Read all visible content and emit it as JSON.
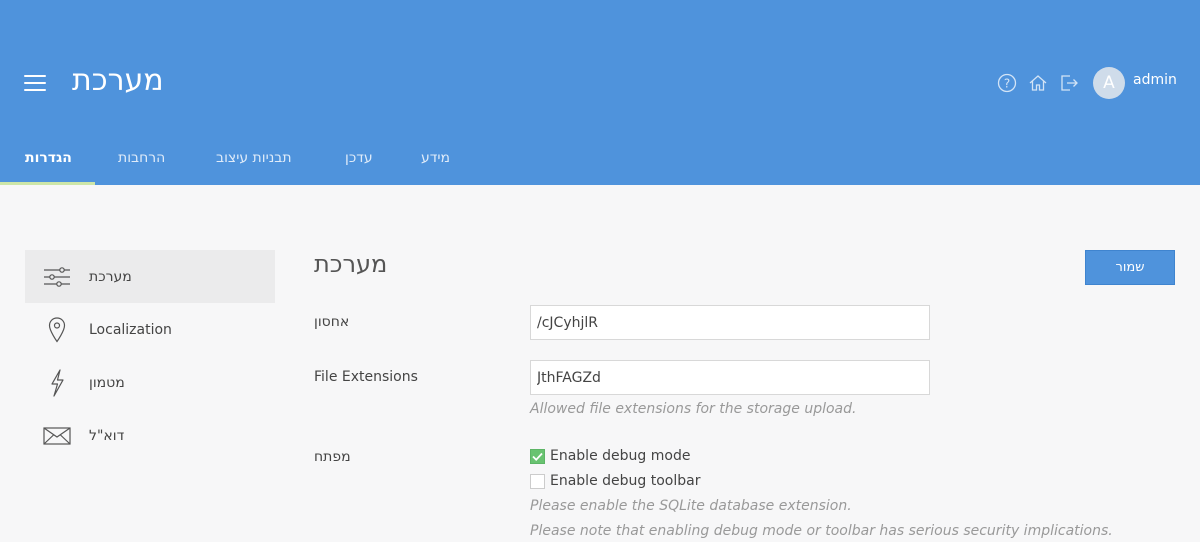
{
  "header": {
    "title": "מערכת",
    "username": "admin",
    "avatar_letter": "A"
  },
  "tabs": [
    {
      "label": "הגדרות",
      "active": true
    },
    {
      "label": "הרחבות",
      "active": false
    },
    {
      "label": "תבניות עיצוב",
      "active": false
    },
    {
      "label": "עדכן",
      "active": false
    },
    {
      "label": "מידע",
      "active": false
    }
  ],
  "sidebar": {
    "items": [
      {
        "label": "מערכת",
        "icon": "sliders-icon",
        "active": true
      },
      {
        "label": "Localization",
        "icon": "map-pin-icon",
        "active": false
      },
      {
        "label": "מטמון",
        "icon": "lightning-icon",
        "active": false
      },
      {
        "label": "דוא\"ל",
        "icon": "envelope-icon",
        "active": false
      }
    ]
  },
  "main": {
    "title": "מערכת",
    "save_label": "שמור",
    "storage": {
      "label": "אחסון",
      "value": "/cJCyhjlR"
    },
    "extensions": {
      "label": "File Extensions",
      "value": "JthFAGZd",
      "hint": "Allowed file extensions for the storage upload."
    },
    "debug": {
      "label": "מפתח",
      "debug_mode": {
        "label": "Enable debug mode",
        "checked": true
      },
      "debug_toolbar": {
        "label": "Enable debug toolbar",
        "checked": false
      },
      "hint1": "Please enable the SQLite database extension.",
      "hint2": "Please note that enabling debug mode or toolbar has serious security implications."
    }
  },
  "colors": {
    "header_bg": "#4f93dc",
    "tab_underline": "#cde6a8",
    "checkbox_checked": "#69c371"
  }
}
